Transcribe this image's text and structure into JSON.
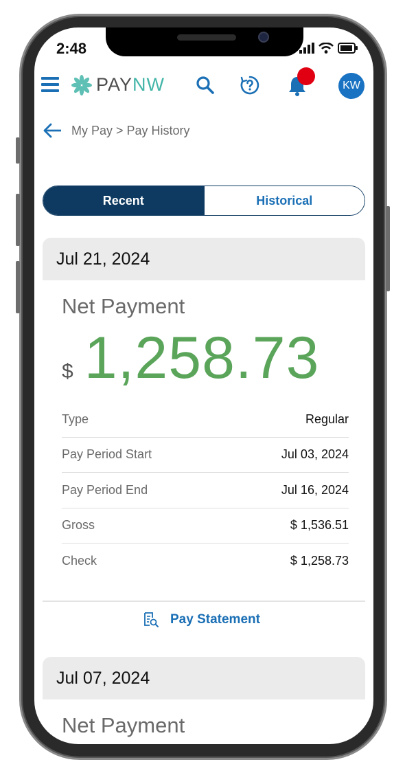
{
  "status_bar": {
    "time": "2:48"
  },
  "header": {
    "logo_pay": "PAY",
    "logo_nw": "NW",
    "avatar_initials": "KW"
  },
  "breadcrumb": {
    "text": "My Pay > Pay History"
  },
  "tabs": {
    "recent": "Recent",
    "historical": "Historical",
    "active": "Recent"
  },
  "payments": [
    {
      "date": "Jul 21, 2024",
      "net_label": "Net Payment",
      "currency_symbol": "$",
      "net_amount": "1,258.73",
      "details": [
        {
          "label": "Type",
          "value": "Regular"
        },
        {
          "label": "Pay Period Start",
          "value": "Jul 03, 2024"
        },
        {
          "label": "Pay Period End",
          "value": "Jul 16, 2024"
        },
        {
          "label": "Gross",
          "value": "$ 1,536.51"
        },
        {
          "label": "Check",
          "value": "$ 1,258.73"
        }
      ],
      "statement_link": "Pay Statement"
    },
    {
      "date": "Jul 07, 2024",
      "net_label": "Net Payment"
    }
  ],
  "colors": {
    "primary_navy": "#0e3a61",
    "link_blue": "#1a6fb5",
    "amount_green": "#5ba55b",
    "notification_red": "#e00012",
    "logo_teal": "#43b5a8"
  }
}
